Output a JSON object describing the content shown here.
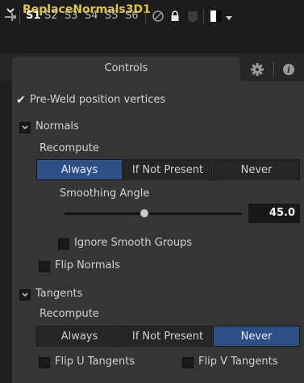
{
  "title": "ReplaceNormals3D1",
  "slots": [
    "S1",
    "S2",
    "S3",
    "S4",
    "S5",
    "S6"
  ],
  "active_slot": "S1",
  "tabs": {
    "controls": "Controls"
  },
  "pre_weld": {
    "label": "Pre-Weld position vertices",
    "checked": true
  },
  "normals": {
    "section": "Normals",
    "recompute_label": "Recompute",
    "options": [
      "Always",
      "If Not Present",
      "Never"
    ],
    "selected": "Always",
    "smoothing_label": "Smoothing Angle",
    "smoothing_value": "45.0",
    "smoothing_fraction": 0.45,
    "ignore_smooth_groups": "Ignore Smooth Groups",
    "flip_normals": "Flip Normals"
  },
  "tangents": {
    "section": "Tangents",
    "recompute_label": "Recompute",
    "options": [
      "Always",
      "If Not Present",
      "Never"
    ],
    "selected": "Never",
    "flip_u": "Flip U Tangents",
    "flip_v": "Flip V Tangents"
  },
  "colors": {
    "title": "#e0c44a",
    "selected": "#2c4f86",
    "panel": "#353535"
  },
  "icons": [
    "chevron-down-icon",
    "pin-icon",
    "no-entry-icon",
    "lock-icon",
    "shield-icon",
    "color-swatch-icon",
    "dropdown-icon",
    "gear-icon",
    "info-icon",
    "checkmark-icon",
    "collapse-icon"
  ]
}
